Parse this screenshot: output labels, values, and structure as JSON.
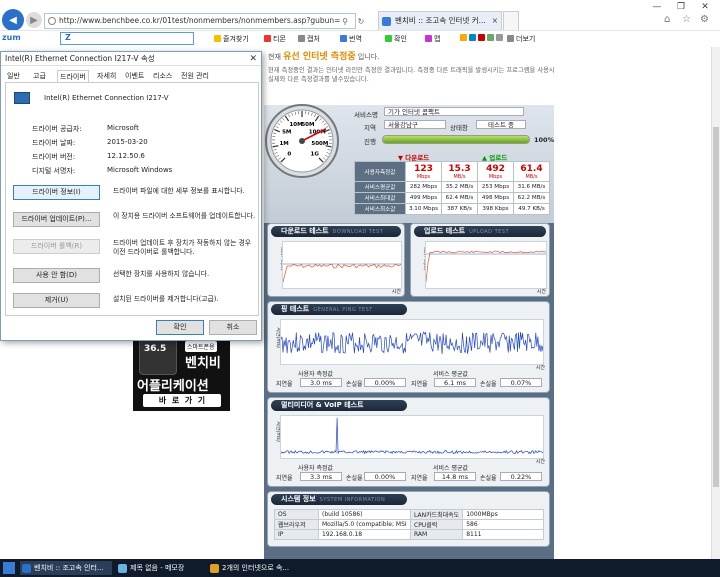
{
  "browser": {
    "url": "http://www.benchbee.co.kr/01test/nonmembers/nonmembers.asp?gubun=",
    "tab_title": "벤치비 :: 조고속 인터넷 커...",
    "zum_label": "zum",
    "zum_search": "Z",
    "favorites": [
      "즐겨찾기",
      "티몬",
      "캡처",
      "번역",
      "확인",
      "맵",
      "더보기"
    ]
  },
  "dialog": {
    "title": "Intel(R) Ethernet Connection I217-V 속성",
    "tabs": [
      "일반",
      "고급",
      "드라이버",
      "자세히",
      "이벤트",
      "리소스",
      "전원 관리"
    ],
    "device_name": "Intel(R) Ethernet Connection I217-V",
    "props": [
      {
        "label": "드라이버 공급자:",
        "value": "Microsoft"
      },
      {
        "label": "드라이버 날짜:",
        "value": "2015-03-20"
      },
      {
        "label": "드라이버 버전:",
        "value": "12.12.50.6"
      },
      {
        "label": "디지털 서명자:",
        "value": "Microsoft Windows"
      }
    ],
    "buttons": [
      {
        "label": "드라이버 정보(I)",
        "desc": "드라이버 파일에 대한 세부 정보를 표시합니다."
      },
      {
        "label": "드라이버 업데이트(P)...",
        "desc": "이 장치용 드라이버 소프트웨어를 업데이트합니다."
      },
      {
        "label": "드라이버 롤백(R)",
        "desc": "드라이버 업데이트 후 장치가 작동하지 않는 경우 이전 드라이버로 롤백합니다."
      },
      {
        "label": "사용 안 함(D)",
        "desc": "선택한 장치를 사용하지 않습니다."
      },
      {
        "label": "제거(U)",
        "desc": "설치된 드라이버를 제거합니다(고급)."
      }
    ],
    "ok": "확인",
    "cancel": "취소"
  },
  "ad": {
    "badge": "스마트폰용",
    "speed": "36.5",
    "line1": "벤치비",
    "line2": "어플리케이션",
    "line3": "바  로  가  기"
  },
  "benchbee": {
    "header_prefix": "현재",
    "header_title": "유선 인터넷 측정중",
    "header_suffix": "입니다.",
    "header_desc": "현재 측정중인 결과는 인터넷 라인만 측정한 결과입니다. 측정중 다른 트래픽을 발생시키는 프로그램을 사용시 실제와 다른 측정결과를 낼수있습니다.",
    "service_label": "서비스명",
    "service_value": "기가 인터넷 콤팩트",
    "region_label": "지역",
    "region_value": "서울강남구",
    "status_label": "상태창",
    "status_value": "테스트 중",
    "progress_label": "진행",
    "progress_pct": "100%",
    "progress": 1.0,
    "gauge": {
      "value": 123,
      "max_label": "1G",
      "marks": [
        "0",
        "1M",
        "5M",
        "10M",
        "50M",
        "100M",
        "500M"
      ]
    },
    "results": {
      "download_label": "다운로드",
      "upload_label": "업로드",
      "rows": [
        {
          "label": "사용자측정값",
          "dl_mbps": "123",
          "dl_mbs": "15.3",
          "ul_mbps": "492",
          "ul_mbs": "61.4"
        },
        {
          "label": "서비스평균값",
          "dl_mbps": "282 Mbps",
          "dl_mbs": "35.2 MB/s",
          "ul_mbps": "253 Mbps",
          "ul_mbs": "31.6 MB/s"
        },
        {
          "label": "서비스최대값",
          "dl_mbps": "499 Mbps",
          "dl_mbs": "62.4 MB/s",
          "ul_mbps": "498 Mbps",
          "ul_mbs": "62.2 MB/s"
        },
        {
          "label": "서비스최소값",
          "dl_mbps": "3.10 Mbps",
          "dl_mbs": "387 KB/s",
          "ul_mbps": "398 Kbps",
          "ul_mbs": "49.7 KB/s"
        }
      ],
      "unit_mbps": "Mbps",
      "unit_mbs": "MB/s"
    },
    "download_test": {
      "title": "다운로드 테스트",
      "sub": "DOWNLOAD TEST",
      "ylabel": "속도(Mbps)",
      "xlabel": "시간"
    },
    "upload_test": {
      "title": "업로드 테스트",
      "sub": "UPLOAD TEST",
      "ylabel": "속도(Mbps)",
      "xlabel": "시간"
    },
    "ping_test": {
      "title": "핑 테스트",
      "sub": "GENERAL PING TEST",
      "ylabel": "지연(ms)",
      "xlabel": "시간",
      "user_label": "사용자 측정값",
      "service_label": "서비스 평균값",
      "delay_label": "지연율",
      "loss_label": "손실율",
      "user_delay": "3.0 ms",
      "user_loss": "0.00%",
      "svc_delay": "6.1 ms",
      "svc_loss": "0.07%"
    },
    "voip_test": {
      "title": "멀티미디어 & VoIP 테스트",
      "sub": "",
      "ylabel": "지연(ms)",
      "xlabel": "시간",
      "user_label": "사용자 측정값",
      "service_label": "서비스 평균값",
      "delay_label": "지연율",
      "loss_label": "손실율",
      "user_delay": "3.3 ms",
      "user_loss": "0.00%",
      "svc_delay": "14.8 ms",
      "svc_loss": "0.22%"
    },
    "sysinfo": {
      "title": "시스템 정보",
      "sub": "SYSTEM INFORMATION",
      "rows": [
        {
          "k1": "OS",
          "v1": "(build 10586)",
          "k2": "LAN카드최대속도",
          "v2": "1000MBps"
        },
        {
          "k1": "웹브라우저",
          "v1": "Mozilla/5.0 (compatible; MSI",
          "k2": "CPU클럭",
          "v2": "586"
        },
        {
          "k1": "IP",
          "v1": "192.168.0.18",
          "k2": "RAM",
          "v2": "8111"
        }
      ]
    }
  },
  "taskbar": [
    {
      "label": "벤치비 :: 조고속 인터...",
      "color": "#2a6fc8"
    },
    {
      "label": "제목 없음 - 메모장",
      "color": "#6ab0e0"
    },
    {
      "label": "2개의 인터넷으로 속...",
      "color": "#e0a020"
    }
  ]
}
